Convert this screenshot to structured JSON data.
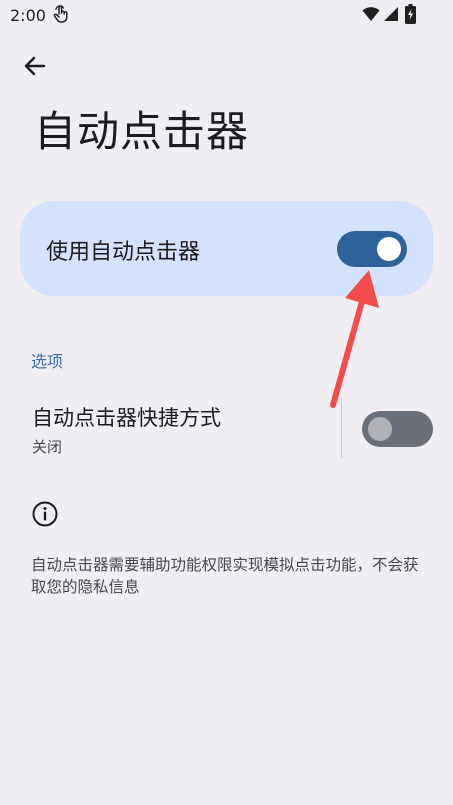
{
  "status_bar": {
    "time": "2:00",
    "icons": [
      "touch-icon",
      "wifi-icon",
      "signal-icon",
      "battery-icon"
    ]
  },
  "header": {
    "back_icon": "arrow-left-icon",
    "title": "自动点击器"
  },
  "main_toggle": {
    "label": "使用自动点击器",
    "checked": true
  },
  "options": {
    "section_label": "选项",
    "shortcut": {
      "title": "自动点击器快捷方式",
      "summary": "关闭",
      "checked": false
    }
  },
  "footer": {
    "icon": "info-icon",
    "text": "自动点击器需要辅助功能权限实现模拟点击功能，不会获取您的隐私信息"
  },
  "colors": {
    "background": "#f0eef3",
    "card": "#d3e3fd",
    "switch_on_track": "#2d6398",
    "switch_off_track": "#6b6f7a",
    "section_header": "#3d6ea8",
    "annotation_arrow": "#f24c4c"
  }
}
